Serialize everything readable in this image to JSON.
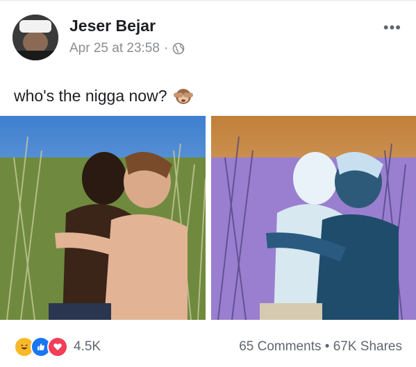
{
  "post": {
    "author": "Jeser Bejar",
    "timestamp": "Apr 25 at 23:58",
    "separator": "·",
    "privacy_icon": "globe-icon",
    "more_icon": "ellipsis-icon",
    "more_label": "•••",
    "caption": "who's the nigga now?",
    "caption_emoji": "see-no-evil-monkey-icon"
  },
  "photos": [
    {
      "description_icon": "photo-original"
    },
    {
      "description_icon": "photo-inverted"
    }
  ],
  "footer": {
    "reactions": [
      "haha-reaction-icon",
      "like-reaction-icon",
      "love-reaction-icon"
    ],
    "reaction_count": "4.5K",
    "comments": "65 Comments",
    "dot": "•",
    "shares": "67K Shares"
  },
  "colors": {
    "text": "#1c1e21",
    "secondary": "#606770",
    "like_blue": "#1877f2",
    "love_red": "#f33e58",
    "haha_yellow": "#f7b928"
  }
}
